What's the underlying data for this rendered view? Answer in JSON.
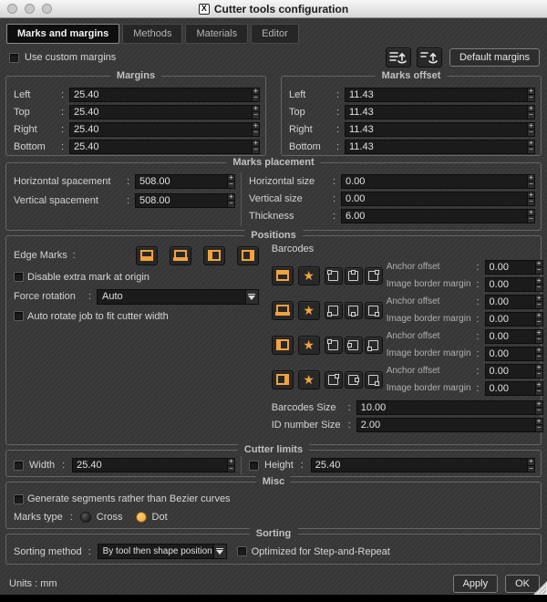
{
  "window": {
    "title": "Cutter tools configuration",
    "x11_glyph": "X"
  },
  "punct": {
    "colon": ":",
    "plus": "+",
    "minus": "−"
  },
  "icons": {
    "star": "★"
  },
  "tabs": [
    {
      "label": "Marks and margins"
    },
    {
      "label": "Methods"
    },
    {
      "label": "Materials"
    },
    {
      "label": "Editor"
    }
  ],
  "header": {
    "use_custom_margins": "Use custom margins",
    "default_margins": "Default margins"
  },
  "margins": {
    "title": "Margins",
    "rows": [
      {
        "label": "Left",
        "value": "25.40"
      },
      {
        "label": "Top",
        "value": "25.40"
      },
      {
        "label": "Right",
        "value": "25.40"
      },
      {
        "label": "Bottom",
        "value": "25.40"
      }
    ]
  },
  "marks_offset": {
    "title": "Marks offset",
    "rows": [
      {
        "label": "Left",
        "value": "11.43"
      },
      {
        "label": "Top",
        "value": "11.43"
      },
      {
        "label": "Right",
        "value": "11.43"
      },
      {
        "label": "Bottom",
        "value": "11.43"
      }
    ]
  },
  "marks_placement": {
    "title": "Marks placement",
    "left_rows": [
      {
        "label": "Horizontal spacement",
        "value": "508.00"
      },
      {
        "label": "Vertical spacement",
        "value": "508.00"
      }
    ],
    "right_rows": [
      {
        "label": "Horizontal size",
        "value": "0.00"
      },
      {
        "label": "Vertical size",
        "value": "0.00"
      },
      {
        "label": "Thickness",
        "value": "6.00"
      }
    ]
  },
  "positions": {
    "title": "Positions",
    "edge_marks_label": "Edge Marks",
    "disable_extra_label": "Disable extra mark at origin",
    "force_rotation_label": "Force rotation",
    "force_rotation_value": "Auto",
    "auto_rotate_label": "Auto rotate job to fit cutter width",
    "barcodes_label": "Barcodes",
    "barcode_rows": [
      {
        "anchor_label": "Anchor offset",
        "anchor_value": "0.00",
        "margin_label": "Image border margin",
        "margin_value": "0.00"
      },
      {
        "anchor_label": "Anchor offset",
        "anchor_value": "0.00",
        "margin_label": "Image border margin",
        "margin_value": "0.00"
      },
      {
        "anchor_label": "Anchor offset",
        "anchor_value": "0.00",
        "margin_label": "Image border margin",
        "margin_value": "0.00"
      },
      {
        "anchor_label": "Anchor offset",
        "anchor_value": "0.00",
        "margin_label": "Image border margin",
        "margin_value": "0.00"
      }
    ],
    "barcodes_size_label": "Barcodes Size",
    "barcodes_size_value": "10.00",
    "id_number_size_label": "ID number Size",
    "id_number_size_value": "2.00"
  },
  "cutter_limits": {
    "title": "Cutter limits",
    "width_label": "Width",
    "width_value": "25.40",
    "height_label": "Height",
    "height_value": "25.40"
  },
  "misc": {
    "title": "Misc",
    "generate_segments_label": "Generate segments rather than Bezier curves",
    "marks_type_label": "Marks type",
    "cross_label": "Cross",
    "dot_label": "Dot"
  },
  "sorting": {
    "title": "Sorting",
    "method_label": "Sorting method",
    "method_value": "By tool then shape position",
    "optimized_label": "Optimized for Step-and-Repeat"
  },
  "footer": {
    "units": "Units : mm",
    "apply": "Apply",
    "ok": "OK"
  },
  "colors": {
    "accent": "#f2a33c",
    "window_bg": "#393939",
    "field_bg": "#1b1b1b"
  }
}
